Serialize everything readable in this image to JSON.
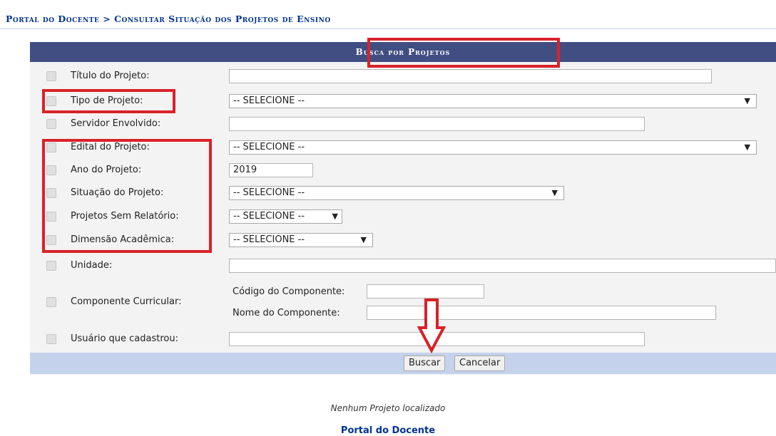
{
  "breadcrumb": "Portal do Docente > Consultar Situação dos Projetos de Ensino",
  "panel": {
    "title": "Busca por Projetos"
  },
  "fields": {
    "titulo": {
      "label": "Título do Projeto:",
      "value": ""
    },
    "tipo": {
      "label": "Tipo de Projeto:",
      "value": "-- SELECIONE --"
    },
    "servidor": {
      "label": "Servidor Envolvido:",
      "value": ""
    },
    "edital": {
      "label": "Edital do Projeto:",
      "value": "-- SELECIONE --"
    },
    "ano": {
      "label": "Ano do Projeto:",
      "value": "2019"
    },
    "situacao": {
      "label": "Situação do Projeto:",
      "value": "-- SELECIONE --"
    },
    "sem_relatorio": {
      "label": "Projetos Sem Relatório:",
      "value": "-- SELECIONE --"
    },
    "dimensao": {
      "label": "Dimensão Acadêmica:",
      "value": "-- SELECIONE --"
    },
    "unidade": {
      "label": "Unidade:",
      "value": ""
    },
    "componente": {
      "label": "Componente Curricular:",
      "codigo_label": "Código do Componente:",
      "codigo_value": "",
      "nome_label": "Nome do Componente:",
      "nome_value": ""
    },
    "usuario": {
      "label": "Usuário que cadastrou:",
      "value": ""
    }
  },
  "dropdown_arrow": "▼",
  "buttons": {
    "buscar": "Buscar",
    "cancelar": "Cancelar"
  },
  "message": "Nenhum Projeto localizado",
  "footer_link": "Portal do Docente",
  "colors": {
    "header_bg": "#404e82",
    "footer_bg": "#c4d2eb",
    "panel_bg": "#f3f3f3",
    "annotation_red": "#d9222a",
    "breadcrumb_text": "#003390"
  },
  "annotations": [
    "red-box-panel-title",
    "red-box-tipo",
    "red-box-group",
    "down-arrow-buscar"
  ]
}
